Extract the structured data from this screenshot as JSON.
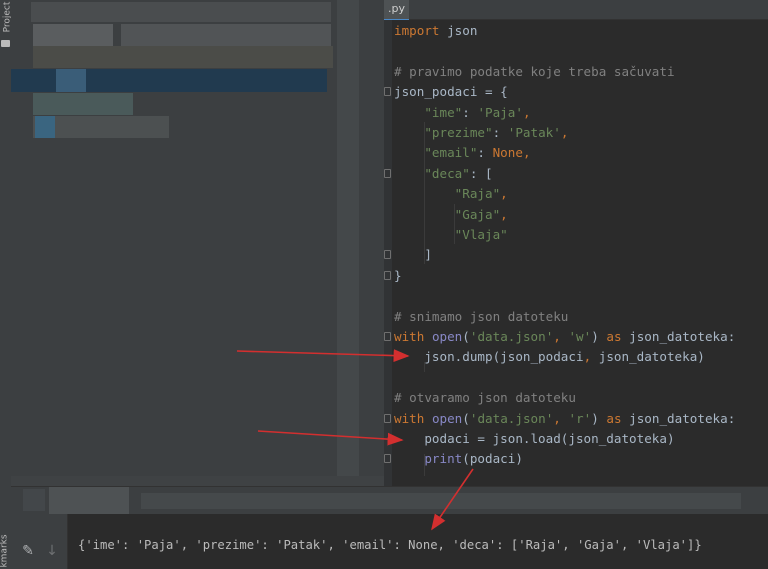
{
  "sidebar": {
    "project_label": "Project",
    "bookmarks_label": "kmarks"
  },
  "editor": {
    "tab_label": ".py",
    "lines": [
      {
        "tokens": [
          {
            "t": "import",
            "c": "kw"
          },
          {
            "t": " json",
            "c": "fn"
          }
        ]
      },
      {
        "tokens": []
      },
      {
        "tokens": [
          {
            "t": "# pravimo podatke koje treba sačuvati",
            "c": "cmt"
          }
        ]
      },
      {
        "tokens": [
          {
            "t": "json_podaci = {",
            "c": "fn"
          }
        ]
      },
      {
        "tokens": [
          {
            "t": "    ",
            "c": "fn"
          },
          {
            "t": "\"ime\"",
            "c": "key"
          },
          {
            "t": ": ",
            "c": "fn"
          },
          {
            "t": "'Paja'",
            "c": "str"
          },
          {
            "t": ",",
            "c": "kw"
          }
        ]
      },
      {
        "tokens": [
          {
            "t": "    ",
            "c": "fn"
          },
          {
            "t": "\"prezime\"",
            "c": "key"
          },
          {
            "t": ": ",
            "c": "fn"
          },
          {
            "t": "'Patak'",
            "c": "str"
          },
          {
            "t": ",",
            "c": "kw"
          }
        ]
      },
      {
        "tokens": [
          {
            "t": "    ",
            "c": "fn"
          },
          {
            "t": "\"email\"",
            "c": "key"
          },
          {
            "t": ": ",
            "c": "fn"
          },
          {
            "t": "None",
            "c": "kw"
          },
          {
            "t": ",",
            "c": "kw"
          }
        ]
      },
      {
        "tokens": [
          {
            "t": "    ",
            "c": "fn"
          },
          {
            "t": "\"deca\"",
            "c": "key"
          },
          {
            "t": ": [",
            "c": "fn"
          }
        ]
      },
      {
        "tokens": [
          {
            "t": "        ",
            "c": "fn"
          },
          {
            "t": "\"Raja\"",
            "c": "str"
          },
          {
            "t": ",",
            "c": "kw"
          }
        ]
      },
      {
        "tokens": [
          {
            "t": "        ",
            "c": "fn"
          },
          {
            "t": "\"Gaja\"",
            "c": "str"
          },
          {
            "t": ",",
            "c": "kw"
          }
        ]
      },
      {
        "tokens": [
          {
            "t": "        ",
            "c": "fn"
          },
          {
            "t": "\"Vlaja\"",
            "c": "str"
          }
        ]
      },
      {
        "tokens": [
          {
            "t": "    ]",
            "c": "fn"
          }
        ]
      },
      {
        "tokens": [
          {
            "t": "}",
            "c": "fn"
          }
        ]
      },
      {
        "tokens": []
      },
      {
        "tokens": [
          {
            "t": "# snimamo json datoteku",
            "c": "cmt"
          }
        ]
      },
      {
        "tokens": [
          {
            "t": "with",
            "c": "kw"
          },
          {
            "t": " ",
            "c": "fn"
          },
          {
            "t": "open",
            "c": "bi"
          },
          {
            "t": "(",
            "c": "fn"
          },
          {
            "t": "'data.json'",
            "c": "str"
          },
          {
            "t": ", ",
            "c": "kw"
          },
          {
            "t": "'w'",
            "c": "str"
          },
          {
            "t": ") ",
            "c": "fn"
          },
          {
            "t": "as",
            "c": "kw"
          },
          {
            "t": " json_datoteka:",
            "c": "fn"
          }
        ]
      },
      {
        "tokens": [
          {
            "t": "    json.dump(json_podaci",
            "c": "fn"
          },
          {
            "t": ", ",
            "c": "kw"
          },
          {
            "t": "json_datoteka)",
            "c": "fn"
          }
        ]
      },
      {
        "tokens": []
      },
      {
        "tokens": [
          {
            "t": "# otvaramo json datoteku",
            "c": "cmt"
          }
        ]
      },
      {
        "tokens": [
          {
            "t": "with",
            "c": "kw"
          },
          {
            "t": " ",
            "c": "fn"
          },
          {
            "t": "open",
            "c": "bi"
          },
          {
            "t": "(",
            "c": "fn"
          },
          {
            "t": "'data.json'",
            "c": "str"
          },
          {
            "t": ", ",
            "c": "kw"
          },
          {
            "t": "'r'",
            "c": "str"
          },
          {
            "t": ") ",
            "c": "fn"
          },
          {
            "t": "as",
            "c": "kw"
          },
          {
            "t": " json_datoteka:",
            "c": "fn"
          }
        ]
      },
      {
        "tokens": [
          {
            "t": "    podaci = json.load(json_datoteka)",
            "c": "fn"
          }
        ]
      },
      {
        "tokens": [
          {
            "t": "    ",
            "c": "fn"
          },
          {
            "t": "print",
            "c": "bi"
          },
          {
            "t": "(podaci)",
            "c": "fn"
          }
        ]
      }
    ]
  },
  "run": {
    "output": "{'ime': 'Paja', 'prezime': 'Patak', 'email': None, 'deca': ['Raja', 'Gaja', 'Vlaja']}"
  },
  "colors": {
    "annotation_arrow": "#d32f2f",
    "keyword": "#cc7832",
    "string": "#6a8759",
    "comment": "#808080",
    "background": "#2b2b2b"
  }
}
